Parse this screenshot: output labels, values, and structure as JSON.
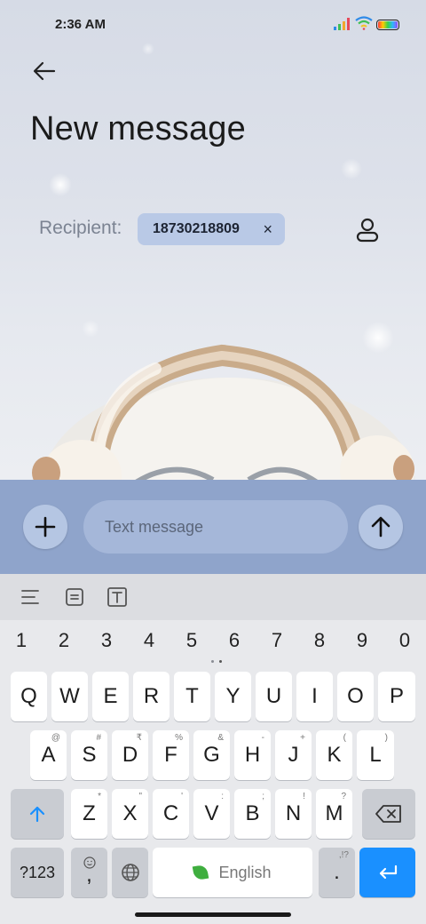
{
  "status_bar": {
    "time": "2:36 AM"
  },
  "header": {
    "title": "New message"
  },
  "recipient": {
    "label": "Recipient:",
    "chip_number": "18730218809",
    "remove_glyph": "×"
  },
  "compose": {
    "placeholder": "Text message"
  },
  "keyboard": {
    "numbers": [
      "1",
      "2",
      "3",
      "4",
      "5",
      "6",
      "7",
      "8",
      "9",
      "0"
    ],
    "row1": [
      "Q",
      "W",
      "E",
      "R",
      "T",
      "Y",
      "U",
      "I",
      "O",
      "P"
    ],
    "row2": [
      "A",
      "S",
      "D",
      "F",
      "G",
      "H",
      "J",
      "K",
      "L"
    ],
    "row2_hints": [
      "@",
      "#",
      "₹",
      "%",
      "&",
      "-",
      "+",
      "(",
      ")"
    ],
    "row3": [
      "Z",
      "X",
      "C",
      "V",
      "B",
      "N",
      "M"
    ],
    "row3_hints": [
      "*",
      "\"",
      "'",
      ":",
      ";",
      "!",
      "?"
    ],
    "symbols_label": "?123",
    "comma_label": ",",
    "space_label": "English",
    "period_label": ".",
    "period_hint": ",!?"
  },
  "colors": {
    "compose_bar": "#8fa4cb",
    "chip": "#b9c9e6",
    "enter_key": "#1a90ff",
    "shift_arrow": "#1a90ff"
  },
  "icons": [
    "back-arrow-icon",
    "contact-icon",
    "plus-icon",
    "send-arrow-icon",
    "align-icon",
    "document-icon",
    "text-box-icon",
    "shift-icon",
    "backspace-icon",
    "emoji-icon",
    "globe-icon",
    "enter-icon"
  ]
}
